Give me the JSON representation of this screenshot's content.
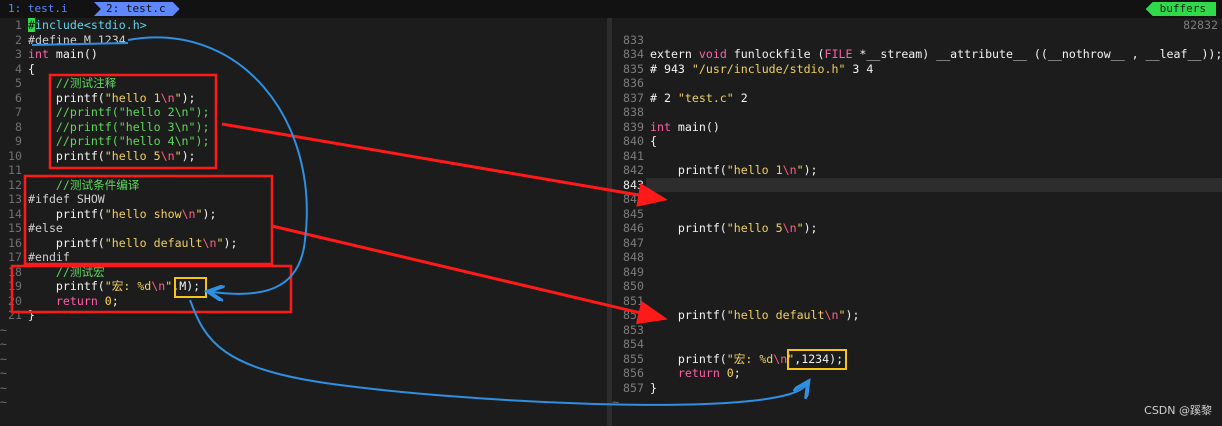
{
  "tabs": [
    {
      "label": "1: test.i"
    },
    {
      "label": "2: test.c"
    }
  ],
  "buffers_label": "buffers",
  "right_top_number": "82832",
  "left_lines": [
    {
      "n": "1",
      "segments": [
        {
          "t": "#",
          "c": "cursor"
        },
        {
          "t": "include",
          "c": "pp"
        },
        {
          "t": "<stdio.h>",
          "c": "pp"
        }
      ]
    },
    {
      "n": "2",
      "segments": [
        {
          "t": "#define M 1234",
          "c": "pp2"
        }
      ]
    },
    {
      "n": "3",
      "segments": [
        {
          "t": "int",
          "c": "type"
        },
        {
          "t": " main()",
          "c": "txt"
        }
      ]
    },
    {
      "n": "4",
      "segments": [
        {
          "t": "{",
          "c": "txt"
        }
      ]
    },
    {
      "n": "5",
      "segments": [
        {
          "t": "    //测试注释",
          "c": "cm"
        }
      ]
    },
    {
      "n": "6",
      "segments": [
        {
          "t": "    printf(",
          "c": "txt"
        },
        {
          "t": "\"hello 1",
          "c": "str"
        },
        {
          "t": "\\n",
          "c": "esc"
        },
        {
          "t": "\"",
          "c": "str"
        },
        {
          "t": ");",
          "c": "txt"
        }
      ]
    },
    {
      "n": "7",
      "segments": [
        {
          "t": "    //printf(\"hello 2\\n\");",
          "c": "cm"
        }
      ]
    },
    {
      "n": "8",
      "segments": [
        {
          "t": "    //printf(\"hello 3\\n\");",
          "c": "cm"
        }
      ]
    },
    {
      "n": "9",
      "segments": [
        {
          "t": "    //printf(\"hello 4\\n\");",
          "c": "cm"
        }
      ]
    },
    {
      "n": "10",
      "segments": [
        {
          "t": "    printf(",
          "c": "txt"
        },
        {
          "t": "\"hello 5",
          "c": "str"
        },
        {
          "t": "\\n",
          "c": "esc"
        },
        {
          "t": "\"",
          "c": "str"
        },
        {
          "t": ");",
          "c": "txt"
        }
      ]
    },
    {
      "n": "11",
      "segments": []
    },
    {
      "n": "12",
      "segments": [
        {
          "t": "    //测试条件编译",
          "c": "cm"
        }
      ]
    },
    {
      "n": "13",
      "segments": [
        {
          "t": "#ifdef SHOW",
          "c": "pp2"
        }
      ]
    },
    {
      "n": "14",
      "segments": [
        {
          "t": "    printf(",
          "c": "txt"
        },
        {
          "t": "\"hello show",
          "c": "str"
        },
        {
          "t": "\\n",
          "c": "esc"
        },
        {
          "t": "\"",
          "c": "str"
        },
        {
          "t": ");",
          "c": "txt"
        }
      ]
    },
    {
      "n": "15",
      "segments": [
        {
          "t": "#else",
          "c": "pp2"
        }
      ]
    },
    {
      "n": "16",
      "segments": [
        {
          "t": "    printf(",
          "c": "txt"
        },
        {
          "t": "\"hello default",
          "c": "str"
        },
        {
          "t": "\\n",
          "c": "esc"
        },
        {
          "t": "\"",
          "c": "str"
        },
        {
          "t": ");",
          "c": "txt"
        }
      ]
    },
    {
      "n": "17",
      "segments": [
        {
          "t": "#endif",
          "c": "pp2"
        }
      ]
    },
    {
      "n": "18",
      "segments": [
        {
          "t": "    //测试宏",
          "c": "cm"
        }
      ]
    },
    {
      "n": "19",
      "segments": [
        {
          "t": "    printf(",
          "c": "txt"
        },
        {
          "t": "\"宏: %d",
          "c": "str"
        },
        {
          "t": "\\n",
          "c": "esc"
        },
        {
          "t": "\"",
          "c": "str"
        },
        {
          "t": ",M);",
          "c": "txt"
        }
      ]
    },
    {
      "n": "20",
      "segments": [
        {
          "t": "    return ",
          "c": "kw"
        },
        {
          "t": "0",
          "c": "strb"
        },
        {
          "t": ";",
          "c": "txt"
        }
      ]
    },
    {
      "n": "21",
      "segments": [
        {
          "t": "}",
          "c": "txt"
        }
      ]
    }
  ],
  "right_lines": [
    {
      "n": "833",
      "segments": []
    },
    {
      "n": "834",
      "segments": [
        {
          "t": "extern ",
          "c": "txt"
        },
        {
          "t": "void",
          "c": "type"
        },
        {
          "t": " funlockfile (",
          "c": "txt"
        },
        {
          "t": "FILE",
          "c": "type"
        },
        {
          "t": " *__stream) __attribute__ ((__nothrow__ , __leaf__));",
          "c": "txt"
        }
      ]
    },
    {
      "n": "835",
      "segments": [
        {
          "t": "# 943 ",
          "c": "txt"
        },
        {
          "t": "\"/usr/include/stdio.h\"",
          "c": "str"
        },
        {
          "t": " 3 4",
          "c": "txt"
        }
      ]
    },
    {
      "n": "836",
      "segments": []
    },
    {
      "n": "837",
      "segments": [
        {
          "t": "# 2 ",
          "c": "txt"
        },
        {
          "t": "\"test.c\"",
          "c": "str"
        },
        {
          "t": " 2",
          "c": "txt"
        }
      ]
    },
    {
      "n": "838",
      "segments": []
    },
    {
      "n": "839",
      "segments": [
        {
          "t": "int",
          "c": "type"
        },
        {
          "t": " main()",
          "c": "txt"
        }
      ]
    },
    {
      "n": "840",
      "segments": [
        {
          "t": "{",
          "c": "txt"
        }
      ]
    },
    {
      "n": "841",
      "segments": []
    },
    {
      "n": "842",
      "segments": [
        {
          "t": "    printf(",
          "c": "txt"
        },
        {
          "t": "\"hello 1",
          "c": "str"
        },
        {
          "t": "\\n",
          "c": "esc"
        },
        {
          "t": "\"",
          "c": "str"
        },
        {
          "t": ");",
          "c": "txt"
        }
      ]
    },
    {
      "n": "843",
      "segments": [],
      "current": true
    },
    {
      "n": "844",
      "segments": []
    },
    {
      "n": "845",
      "segments": []
    },
    {
      "n": "846",
      "segments": [
        {
          "t": "    printf(",
          "c": "txt"
        },
        {
          "t": "\"hello 5",
          "c": "str"
        },
        {
          "t": "\\n",
          "c": "esc"
        },
        {
          "t": "\"",
          "c": "str"
        },
        {
          "t": ");",
          "c": "txt"
        }
      ]
    },
    {
      "n": "847",
      "segments": []
    },
    {
      "n": "848",
      "segments": []
    },
    {
      "n": "849",
      "segments": []
    },
    {
      "n": "850",
      "segments": []
    },
    {
      "n": "851",
      "segments": []
    },
    {
      "n": "852",
      "segments": [
        {
          "t": "    printf(",
          "c": "txt"
        },
        {
          "t": "\"hello default",
          "c": "str"
        },
        {
          "t": "\\n",
          "c": "esc"
        },
        {
          "t": "\"",
          "c": "str"
        },
        {
          "t": ");",
          "c": "txt"
        }
      ]
    },
    {
      "n": "853",
      "segments": []
    },
    {
      "n": "854",
      "segments": []
    },
    {
      "n": "855",
      "segments": [
        {
          "t": "    printf(",
          "c": "txt"
        },
        {
          "t": "\"宏: %d",
          "c": "str"
        },
        {
          "t": "\\n",
          "c": "esc"
        },
        {
          "t": "\"",
          "c": "str"
        },
        {
          "t": ",1234);",
          "c": "txt"
        }
      ]
    },
    {
      "n": "856",
      "segments": [
        {
          "t": "    return ",
          "c": "kw"
        },
        {
          "t": "0",
          "c": "strb"
        },
        {
          "t": ";",
          "c": "txt"
        }
      ]
    },
    {
      "n": "857",
      "segments": [
        {
          "t": "}",
          "c": "txt"
        }
      ]
    }
  ],
  "tilde": "~",
  "watermark": "CSDN @蹊黎",
  "colors": {
    "annotation_red": "#ff1a1a",
    "annotation_blue": "#2f8fe0",
    "annotation_yellow": "#f5c518",
    "accent_blue": "#5f87ff",
    "buffers_green": "#2fd94a"
  }
}
